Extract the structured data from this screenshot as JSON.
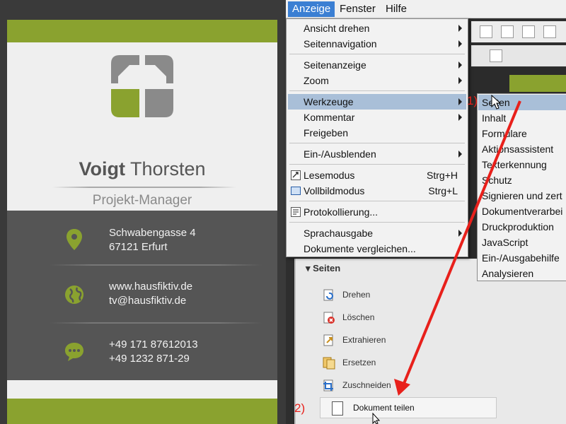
{
  "card": {
    "name_first": "Voigt",
    "name_last": "Thorsten",
    "role": "Projekt-Manager",
    "address_line1": "Schwabengasse 4",
    "address_line2": "67121 Erfurt",
    "web": "www.hausfiktiv.de",
    "email": "tv@hausfiktiv.de",
    "phone1": "+49 171 87612013",
    "phone2": "+49 1232 871-29",
    "colors": {
      "accent": "#8aa22f",
      "dark": "#555555",
      "light": "#efefef"
    },
    "icons": [
      "house-logo-icon",
      "map-pin-icon",
      "globe-icon",
      "chat-bubble-icon"
    ]
  },
  "menubar": {
    "items": [
      {
        "label": "Anzeige",
        "active": true
      },
      {
        "label": "Fenster",
        "active": false
      },
      {
        "label": "Hilfe",
        "active": false
      }
    ]
  },
  "dropdown": {
    "items": [
      {
        "label": "Ansicht drehen",
        "submenu": true
      },
      {
        "label": "Seitennavigation",
        "submenu": true
      },
      {
        "label": "Seitenanzeige",
        "submenu": true
      },
      {
        "label": "Zoom",
        "submenu": true
      },
      {
        "label": "Werkzeuge",
        "submenu": true,
        "highlighted": true
      },
      {
        "label": "Kommentar",
        "submenu": true
      },
      {
        "label": "Freigeben",
        "submenu": false
      },
      {
        "label": "Ein-/Ausblenden",
        "submenu": true
      },
      {
        "label": "Lesemodus",
        "shortcut": "Strg+H",
        "icon": "read-mode-icon"
      },
      {
        "label": "Vollbildmodus",
        "shortcut": "Strg+L",
        "icon": "fullscreen-icon"
      },
      {
        "label": "Protokollierung...",
        "icon": "logging-icon"
      },
      {
        "label": "Sprachausgabe",
        "submenu": true
      },
      {
        "label": "Dokumente vergleichen...",
        "submenu": false
      }
    ]
  },
  "submenu": {
    "items": [
      "Seiten",
      "Inhalt",
      "Formulare",
      "Aktionsassistent",
      "Texterkennung",
      "Schutz",
      "Signieren und zert",
      "Dokumentverarbei",
      "Druckproduktion",
      "JavaScript",
      "Ein-/Ausgabehilfe",
      "Analysieren"
    ]
  },
  "pages_panel": {
    "header": "Seiten",
    "items": [
      {
        "label": "Drehen",
        "icon": "rotate-icon"
      },
      {
        "label": "Löschen",
        "icon": "delete-page-icon"
      },
      {
        "label": "Extrahieren",
        "icon": "extract-icon"
      },
      {
        "label": "Ersetzen",
        "icon": "replace-icon"
      },
      {
        "label": "Zuschneiden",
        "icon": "crop-icon"
      }
    ],
    "split_label": "Dokument teilen"
  },
  "annotations": {
    "step1": "1)",
    "step2": "2)",
    "arrow_color": "#e8201b"
  }
}
